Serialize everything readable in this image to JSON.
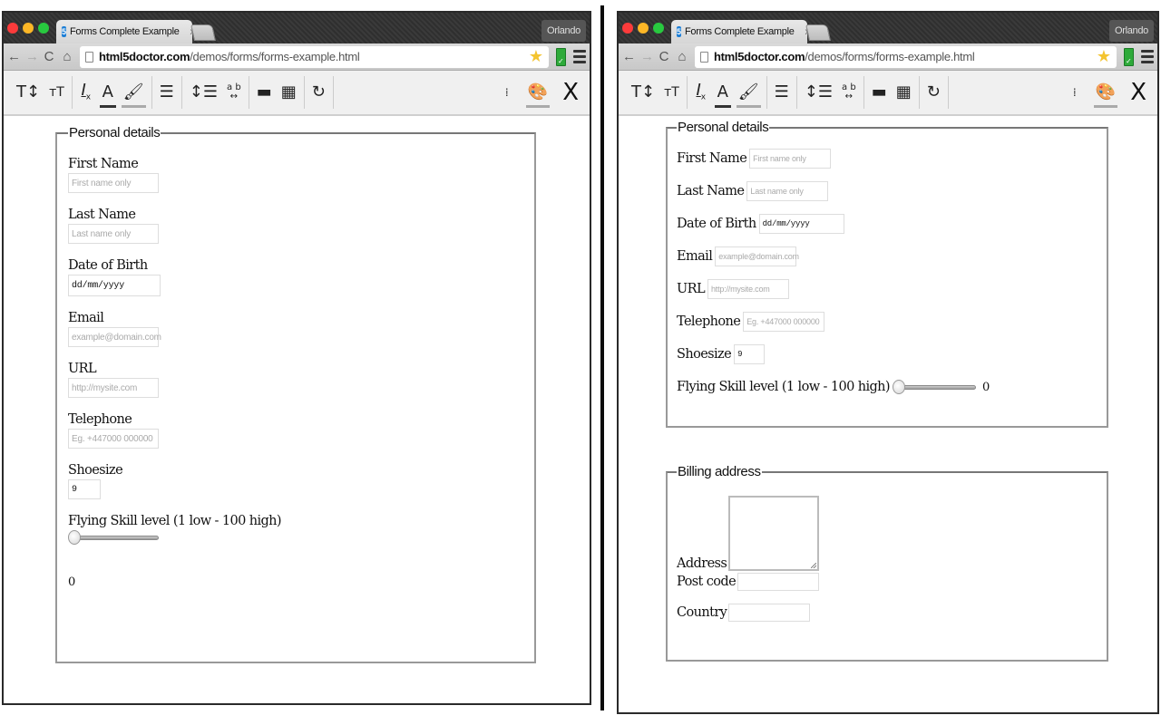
{
  "browser": {
    "tab_title": "Forms Complete Example",
    "tab_close": "x",
    "profile_name": "Orlando",
    "url_domain": "html5doctor.com",
    "url_path": "/demos/forms/forms-example.html"
  },
  "toolbar": {
    "icons": [
      "font-size-icon",
      "font-size-small-icon",
      "clear-format-icon",
      "text-color-icon",
      "highlight-color-icon",
      "align-icon",
      "line-spacing-icon",
      "letter-spacing-icon",
      "ruler-icon",
      "grid-icon",
      "refresh-icon",
      "more-icon",
      "palette-icon",
      "close-icon"
    ],
    "text_color_bar": "#333333",
    "highlight_color_bar": "#aaaaaa",
    "close_label": "X"
  },
  "left_form": {
    "legend": "Personal details",
    "fields": [
      {
        "label": "First Name",
        "placeholder": "First name only",
        "value": ""
      },
      {
        "label": "Last Name",
        "placeholder": "Last name only",
        "value": ""
      },
      {
        "label": "Date of Birth",
        "placeholder": "",
        "value": "dd/mm/yyyy"
      },
      {
        "label": "Email",
        "placeholder": "example@domain.com",
        "value": ""
      },
      {
        "label": "URL",
        "placeholder": "http://mysite.com",
        "value": ""
      },
      {
        "label": "Telephone",
        "placeholder": "Eg. +447000 000000",
        "value": ""
      },
      {
        "label": "Shoesize",
        "placeholder": "",
        "value": "9"
      }
    ],
    "skill_label": "Flying Skill level (1 low - 100 high)",
    "skill_value": 0,
    "skill_output": "0"
  },
  "right_form": {
    "personal": {
      "legend": "Personal details",
      "fields": [
        {
          "label": "First Name",
          "placeholder": "First name only",
          "value": ""
        },
        {
          "label": "Last Name",
          "placeholder": "Last name only",
          "value": ""
        },
        {
          "label": "Date of Birth",
          "placeholder": "",
          "value": "dd/mm/yyyy"
        },
        {
          "label": "Email",
          "placeholder": "example@domain.com",
          "value": ""
        },
        {
          "label": "URL",
          "placeholder": "http://mysite.com",
          "value": ""
        },
        {
          "label": "Telephone",
          "placeholder": "Eg. +447000 000000",
          "value": ""
        },
        {
          "label": "Shoesize",
          "placeholder": "",
          "value": "9"
        }
      ],
      "skill_label": "Flying Skill level (1 low - 100 high)",
      "skill_value": 0,
      "skill_output": "0"
    },
    "billing": {
      "legend": "Billing address",
      "address_label": "Address",
      "postcode_label": "Post code",
      "country_label": "Country"
    }
  }
}
